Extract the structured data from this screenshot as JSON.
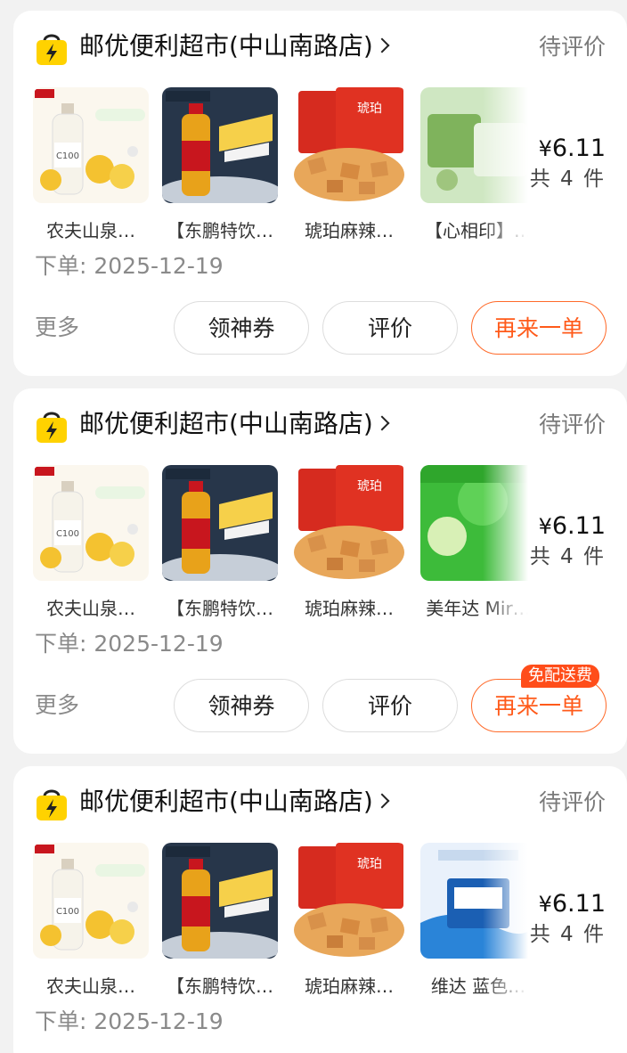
{
  "orders": [
    {
      "shop_name": "邮优便利超市(中山南路店)",
      "status": "待评价",
      "products": [
        {
          "name": "农夫山泉…",
          "image": "lemon-drink"
        },
        {
          "name": "【东鹏特饮…",
          "image": "energy-drink"
        },
        {
          "name": "琥珀麻辣…",
          "image": "crackers"
        },
        {
          "name": "【心相印】…",
          "image": "tissue-green"
        }
      ],
      "price_symbol": "¥",
      "price": "6.11",
      "count": "共 4 件",
      "order_date": "下单: 2025-12-19",
      "more": "更多",
      "coupon_btn": "领神券",
      "review_btn": "评价",
      "reorder_btn": "再来一单"
    },
    {
      "shop_name": "邮优便利超市(中山南路店)",
      "status": "待评价",
      "products": [
        {
          "name": "农夫山泉…",
          "image": "lemon-drink"
        },
        {
          "name": "【东鹏特饮…",
          "image": "energy-drink"
        },
        {
          "name": "琥珀麻辣…",
          "image": "crackers"
        },
        {
          "name": "美年达 Mir…",
          "image": "apple-soda"
        }
      ],
      "price_symbol": "¥",
      "price": "6.11",
      "count": "共 4 件",
      "order_date": "下单: 2025-12-19",
      "more": "更多",
      "coupon_btn": "领神券",
      "review_btn": "评价",
      "reorder_btn": "再来一单",
      "badge": "免配送费"
    },
    {
      "shop_name": "邮优便利超市(中山南路店)",
      "status": "待评价",
      "products": [
        {
          "name": "农夫山泉…",
          "image": "lemon-drink"
        },
        {
          "name": "【东鹏特饮…",
          "image": "energy-drink"
        },
        {
          "name": "琥珀麻辣…",
          "image": "crackers"
        },
        {
          "name": "维达 蓝色…",
          "image": "tissue-blue"
        }
      ],
      "price_symbol": "¥",
      "price": "6.11",
      "count": "共 4 件",
      "order_date": "下单: 2025-12-19"
    }
  ],
  "colors": {
    "accent": "#ff5a1a",
    "badge": "#ff4d1a",
    "shop_icon": "#ffd200"
  }
}
